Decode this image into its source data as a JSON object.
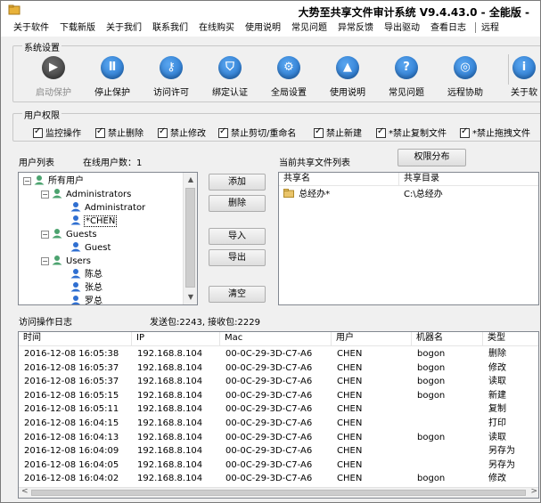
{
  "window": {
    "title": "大势至共享文件审计系统 V9.4.43.0 - 全能版 -"
  },
  "menu": [
    "关于软件",
    "下载新版",
    "关于我们",
    "联系我们",
    "在线购买",
    "使用说明",
    "常见问题",
    "异常反馈",
    "导出驱动",
    "查看日志",
    "远程"
  ],
  "system_settings": {
    "label": "系统设置",
    "tools": [
      {
        "label": "启动保护",
        "icon": "play-icon",
        "disabled": true
      },
      {
        "label": "停止保护",
        "icon": "pause-icon"
      },
      {
        "label": "访问许可",
        "icon": "key-icon"
      },
      {
        "label": "绑定认证",
        "icon": "shield-icon"
      },
      {
        "label": "全局设置",
        "icon": "gear-icon"
      },
      {
        "label": "使用说明",
        "icon": "graduation-cap-icon"
      },
      {
        "label": "常见问题",
        "icon": "question-icon"
      },
      {
        "label": "远程协助",
        "icon": "globe-icon"
      },
      {
        "label": "关于软",
        "icon": "info-icon"
      }
    ]
  },
  "user_permissions": {
    "label": "用户权限",
    "items": [
      "监控操作",
      "禁止删除",
      "禁止修改",
      "禁止剪切/重命名",
      "禁止新建",
      "*禁止复制文件",
      "*禁止拖拽文件"
    ]
  },
  "users": {
    "list_label": "用户列表",
    "online_label": "在线用户数：1",
    "tree": {
      "root": "所有用户",
      "groups": [
        {
          "name": "Administrators",
          "members": [
            "Administrator",
            "*CHEN"
          ]
        },
        {
          "name": "Guests",
          "members": [
            "Guest"
          ]
        },
        {
          "name": "Users",
          "members": [
            "陈总",
            "张总",
            "罗总"
          ]
        }
      ]
    }
  },
  "buttons": {
    "add": "添加",
    "delete": "删除",
    "import": "导入",
    "export": "导出",
    "clear": "清空",
    "perm_dist": "权限分布"
  },
  "shares": {
    "label": "当前共享文件列表",
    "columns": [
      "共享名",
      "共享目录"
    ],
    "rows": [
      {
        "name": "总经办*",
        "dir": "C:\\总经办"
      }
    ]
  },
  "log": {
    "label": "访问操作日志",
    "stats": "发送包:2243, 接收包:2229",
    "columns": [
      "时间",
      "IP",
      "Mac",
      "用户",
      "机器名",
      "类型"
    ],
    "rows": [
      [
        "2016-12-08 16:05:38",
        "192.168.8.104",
        "00-0C-29-3D-C7-A6",
        "CHEN",
        "bogon",
        "删除"
      ],
      [
        "2016-12-08 16:05:37",
        "192.168.8.104",
        "00-0C-29-3D-C7-A6",
        "CHEN",
        "bogon",
        "修改"
      ],
      [
        "2016-12-08 16:05:37",
        "192.168.8.104",
        "00-0C-29-3D-C7-A6",
        "CHEN",
        "bogon",
        "读取"
      ],
      [
        "2016-12-08 16:05:15",
        "192.168.8.104",
        "00-0C-29-3D-C7-A6",
        "CHEN",
        "bogon",
        "新建"
      ],
      [
        "2016-12-08 16:05:11",
        "192.168.8.104",
        "00-0C-29-3D-C7-A6",
        "CHEN",
        "",
        "复制"
      ],
      [
        "2016-12-08 16:04:15",
        "192.168.8.104",
        "00-0C-29-3D-C7-A6",
        "CHEN",
        "",
        "打印"
      ],
      [
        "2016-12-08 16:04:13",
        "192.168.8.104",
        "00-0C-29-3D-C7-A6",
        "CHEN",
        "bogon",
        "读取"
      ],
      [
        "2016-12-08 16:04:09",
        "192.168.8.104",
        "00-0C-29-3D-C7-A6",
        "CHEN",
        "",
        "另存为"
      ],
      [
        "2016-12-08 16:04:05",
        "192.168.8.104",
        "00-0C-29-3D-C7-A6",
        "CHEN",
        "",
        "另存为"
      ],
      [
        "2016-12-08 16:04:02",
        "192.168.8.104",
        "00-0C-29-3D-C7-A6",
        "CHEN",
        "bogon",
        "修改"
      ]
    ]
  },
  "colors": {
    "tool_blue": "#1f6fc9",
    "tool_gray": "#3c3c3c"
  }
}
